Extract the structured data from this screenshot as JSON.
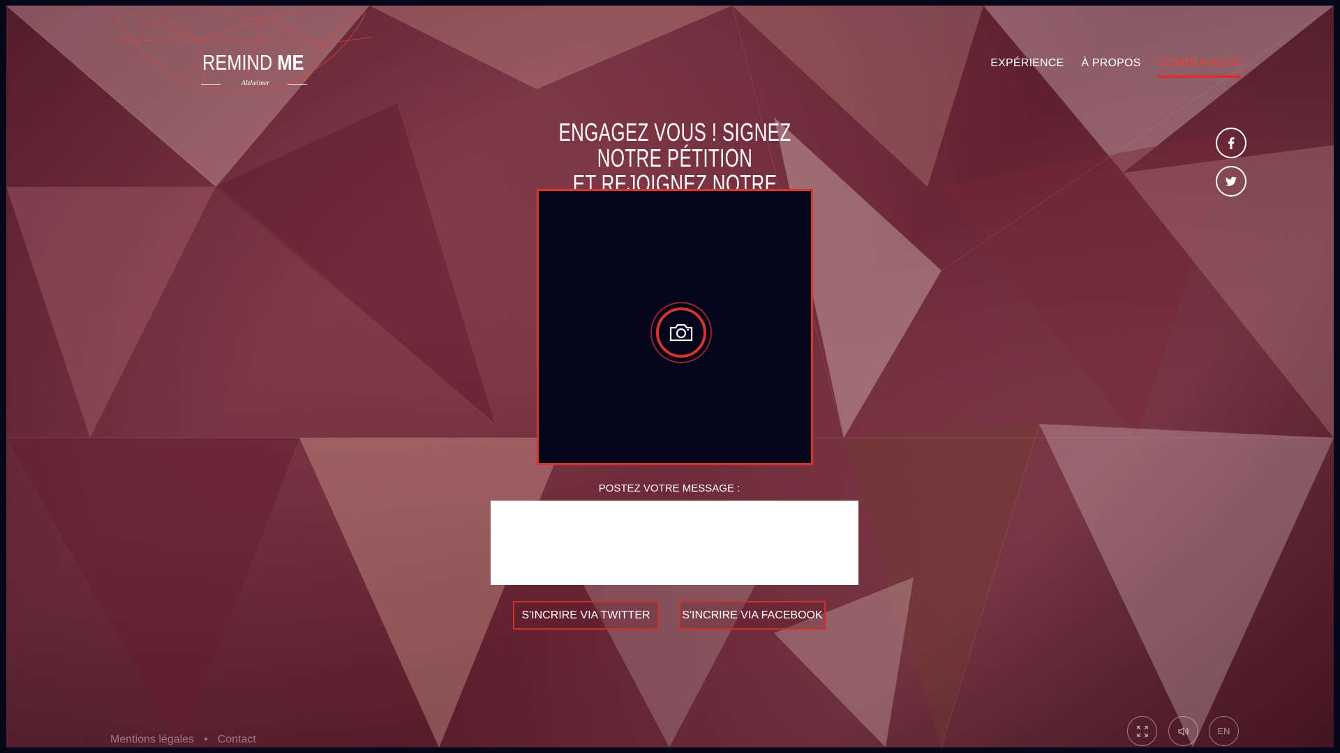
{
  "logo": {
    "name_light": "REMIND ",
    "name_bold": "ME",
    "subtitle": "Alzheimer"
  },
  "nav": {
    "items": [
      {
        "label": "EXPÉRIENCE",
        "active": false
      },
      {
        "label": "À PROPOS",
        "active": false
      },
      {
        "label": "COMMUNAUTÉ",
        "active": true
      }
    ]
  },
  "social": {
    "facebook_icon": "facebook-icon",
    "twitter_icon": "twitter-icon"
  },
  "main": {
    "heading_line1": "ENGAGEZ VOUS ! SIGNEZ NOTRE PÉTITION",
    "heading_line2": "ET REJOIGNEZ NOTRE COMMUNAUTÉ.",
    "camera_icon": "camera-icon",
    "message_label": "POSTEZ VOTRE MESSAGE :",
    "message_value": "",
    "twitter_button": "S'INCRIRE VIA TWITTER",
    "facebook_button": "S'INCRIRE VIA FACEBOOK"
  },
  "footer": {
    "legal": "Mentions légales",
    "separator": "•",
    "contact": "Contact"
  },
  "controls": {
    "fullscreen_icon": "fullscreen-icon",
    "sound_icon": "sound-icon",
    "language": "EN"
  },
  "colors": {
    "accent": "#d6342f",
    "panel": "#04041a",
    "background": "#7a3342"
  }
}
